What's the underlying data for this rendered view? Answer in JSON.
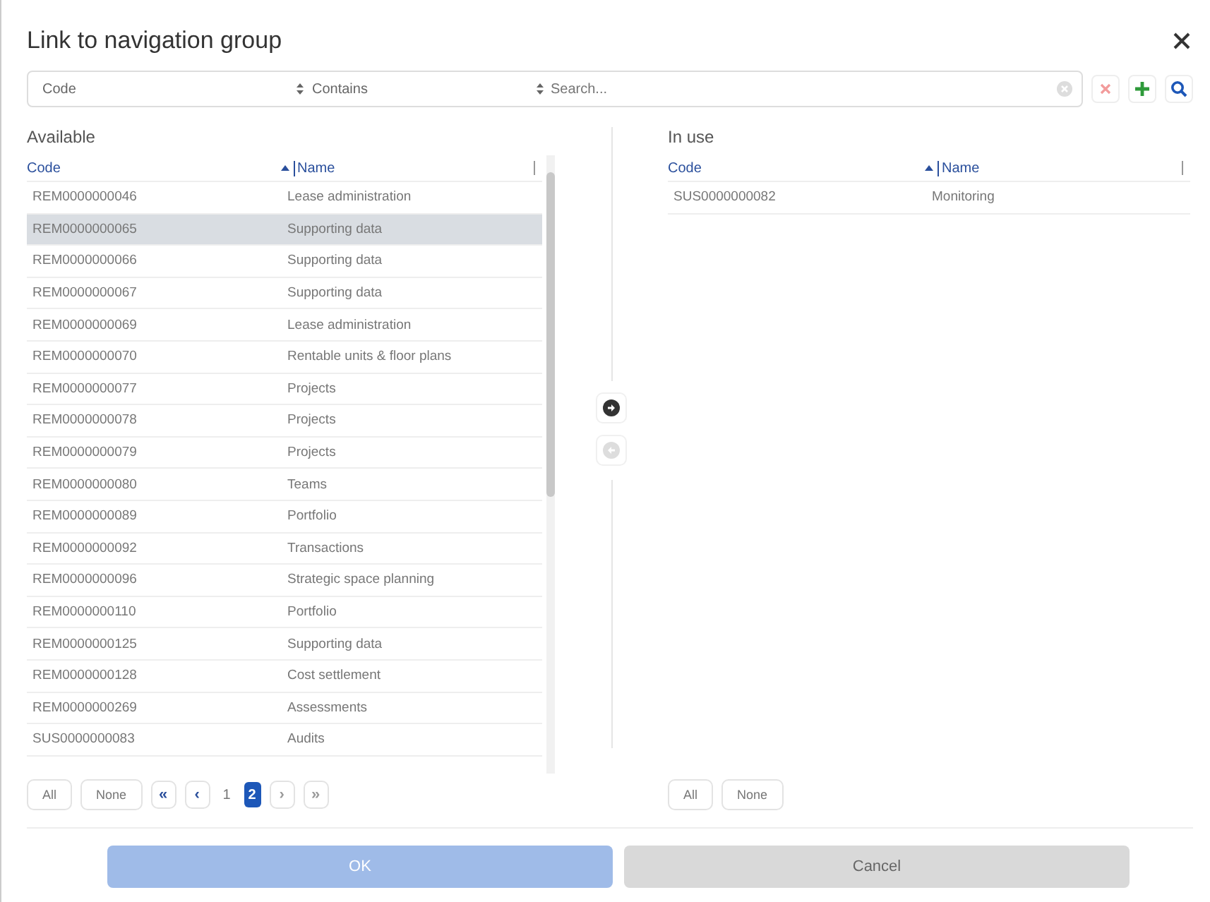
{
  "dialog": {
    "title": "Link to navigation group"
  },
  "filter": {
    "field": "Code",
    "operator": "Contains",
    "placeholder": "Search..."
  },
  "available": {
    "title": "Available",
    "columns": [
      "Code",
      "Name"
    ],
    "rows": [
      {
        "code": "REM0000000046",
        "name": "Lease administration",
        "selected": false
      },
      {
        "code": "REM0000000065",
        "name": "Supporting data",
        "selected": true
      },
      {
        "code": "REM0000000066",
        "name": "Supporting data",
        "selected": false
      },
      {
        "code": "REM0000000067",
        "name": "Supporting data",
        "selected": false
      },
      {
        "code": "REM0000000069",
        "name": "Lease administration",
        "selected": false
      },
      {
        "code": "REM0000000070",
        "name": "Rentable units & floor plans",
        "selected": false
      },
      {
        "code": "REM0000000077",
        "name": "Projects",
        "selected": false
      },
      {
        "code": "REM0000000078",
        "name": "Projects",
        "selected": false
      },
      {
        "code": "REM0000000079",
        "name": "Projects",
        "selected": false
      },
      {
        "code": "REM0000000080",
        "name": "Teams",
        "selected": false
      },
      {
        "code": "REM0000000089",
        "name": "Portfolio",
        "selected": false
      },
      {
        "code": "REM0000000092",
        "name": "Transactions",
        "selected": false
      },
      {
        "code": "REM0000000096",
        "name": "Strategic space planning",
        "selected": false
      },
      {
        "code": "REM0000000110",
        "name": "Portfolio",
        "selected": false
      },
      {
        "code": "REM0000000125",
        "name": "Supporting data",
        "selected": false
      },
      {
        "code": "REM0000000128",
        "name": "Cost settlement",
        "selected": false
      },
      {
        "code": "REM0000000269",
        "name": "Assessments",
        "selected": false
      },
      {
        "code": "SUS0000000083",
        "name": "Audits",
        "selected": false
      }
    ],
    "buttons": [
      "All",
      "None"
    ],
    "pager": [
      {
        "label": "«",
        "kind": "nav",
        "disabled": false
      },
      {
        "label": "‹",
        "kind": "nav",
        "disabled": false
      },
      {
        "label": "1",
        "kind": "page",
        "selected": false
      },
      {
        "label": "2",
        "kind": "page",
        "selected": true
      },
      {
        "label": "›",
        "kind": "nav",
        "disabled": true
      },
      {
        "label": "»",
        "kind": "nav",
        "disabled": true
      }
    ]
  },
  "transfer": {
    "add_disabled": false,
    "remove_disabled": true
  },
  "in_use": {
    "title": "In use",
    "columns": [
      "Code",
      "Name"
    ],
    "rows": [
      {
        "code": "SUS0000000082",
        "name": "Monitoring",
        "selected": false
      }
    ],
    "buttons": [
      "All",
      "None"
    ]
  },
  "footer": {
    "ok": {
      "label": "OK",
      "disabled": true
    },
    "cancel": {
      "label": "Cancel"
    }
  }
}
